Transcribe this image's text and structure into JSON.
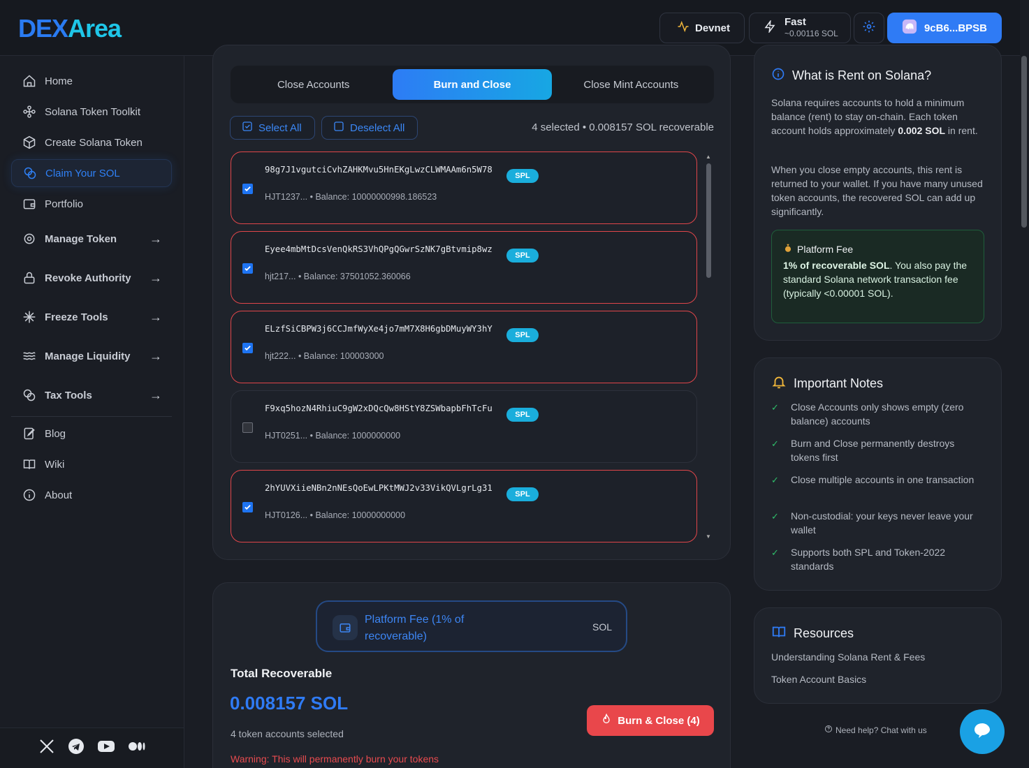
{
  "brand": {
    "logo_main": "DEX",
    "logo_accent": "Area"
  },
  "topbar": {
    "network_label": "Devnet",
    "speed_label": "Fast",
    "speed_fee": "~0.00116 SOL",
    "wallet_label": "9cB6...BPSB"
  },
  "sidebar": {
    "items": [
      {
        "label": "Home"
      },
      {
        "label": "Solana Token Toolkit"
      },
      {
        "label": "Create Solana Token"
      },
      {
        "label": "Claim Your SOL"
      },
      {
        "label": "Portfolio"
      },
      {
        "label": "Manage Token"
      },
      {
        "label": "Revoke Authority"
      },
      {
        "label": "Freeze Tools"
      },
      {
        "label": "Manage Liquidity"
      },
      {
        "label": "Tax Tools"
      },
      {
        "label": "Blog"
      },
      {
        "label": "Wiki"
      },
      {
        "label": "About"
      }
    ],
    "arrow": "→"
  },
  "tabs": [
    {
      "label": "Close Accounts"
    },
    {
      "label": "Burn and Close"
    },
    {
      "label": "Close Mint Accounts"
    }
  ],
  "selection": {
    "select_all": "Select All",
    "deselect_all": "Deselect All",
    "summary": "4 selected • 0.008157 SOL recoverable"
  },
  "accounts": [
    {
      "mint": "98g7J1vgutciCvhZAHKMvu5HnEKgLwzCLWMAAm6n5W78",
      "badge": "SPL",
      "meta": "HJT1237... • Balance: 10000000998.186523",
      "checked": true
    },
    {
      "mint": "Eyee4mbMtDcsVenQkRS3VhQPgQGwrSzNK7gBtvmip8wz",
      "badge": "SPL",
      "meta": "hjt217... • Balance: 37501052.360066",
      "checked": true
    },
    {
      "mint": "ELzfSiCBPW3j6CCJmfWyXe4jo7mM7X8H6gbDMuyWY3hY",
      "badge": "SPL",
      "meta": "hjt222... • Balance: 100003000",
      "checked": true
    },
    {
      "mint": "F9xq5hozN4RhiuC9gW2xDQcQw8HStY8ZSWbapbFhTcFu",
      "badge": "SPL",
      "meta": "HJT0251... • Balance: 1000000000",
      "checked": false
    },
    {
      "mint": "2hYUVXiieNBn2nNEsQoEwLPKtMWJ2v33VikQVLgrLg31",
      "badge": "SPL",
      "meta": "HJT0126... • Balance: 10000000000",
      "checked": true
    }
  ],
  "summary": {
    "platform_fee_label": "Platform Fee (1% of recoverable)",
    "platform_fee_unit": "SOL",
    "total_title": "Total Recoverable",
    "total_value": "0.008157 SOL",
    "accounts_selected": "4 token accounts selected",
    "warning": "Warning: This will permanently burn your tokens",
    "burn_button": "Burn & Close (4)"
  },
  "rent_info": {
    "title": "What is Rent on Solana?",
    "para1_pre": "Solana requires accounts to hold a minimum balance (rent) to stay on-chain. Each token account holds approximately ",
    "para1_bold": "0.002 SOL",
    "para1_post": " in rent.",
    "para2": "When you close empty accounts, this rent is returned to your wallet. If you have many unused token accounts, the recovered SOL can add up significantly.",
    "fee_title": "Platform Fee",
    "fee_bold": "1% of recoverable SOL",
    "fee_text": ". You also pay the standard Solana network transaction fee (typically <0.00001 SOL)."
  },
  "notes": {
    "title": "Important Notes",
    "items": [
      "Close Accounts only shows empty (zero balance) accounts",
      "Burn and Close permanently destroys tokens first",
      "Close multiple accounts in one transaction",
      "Non-custodial: your keys never leave your wallet",
      "Supports both SPL and Token-2022 standards"
    ]
  },
  "resources": {
    "title": "Resources",
    "links": [
      "Understanding Solana Rent & Fees",
      "Token Account Basics"
    ]
  },
  "help": {
    "label": "Need help? Chat with us"
  },
  "colors": {
    "accent": "#2f7bf5",
    "danger": "#e9474b",
    "success": "#2fbf6b"
  }
}
